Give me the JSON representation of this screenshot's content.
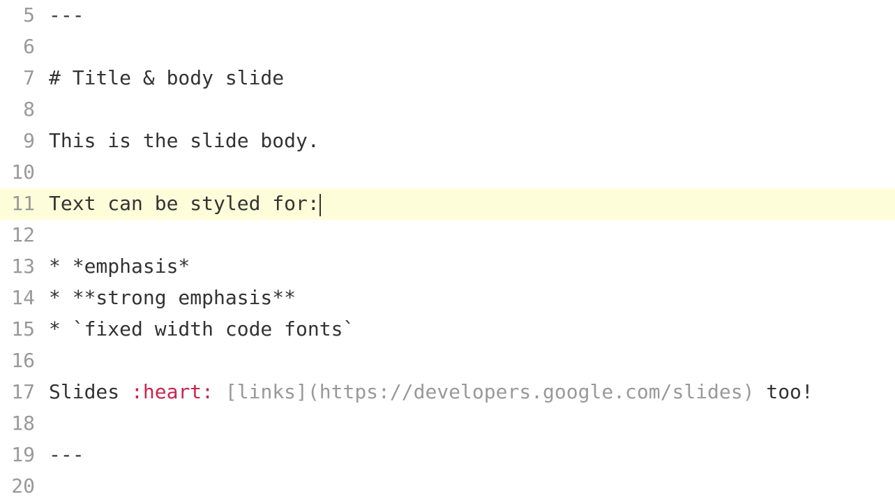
{
  "lines": [
    {
      "num": "5",
      "active": false,
      "segments": [
        {
          "text": "---"
        }
      ]
    },
    {
      "num": "6",
      "active": false,
      "segments": [
        {
          "text": ""
        }
      ]
    },
    {
      "num": "7",
      "active": false,
      "segments": [
        {
          "text": "# Title & body slide"
        }
      ]
    },
    {
      "num": "8",
      "active": false,
      "segments": [
        {
          "text": ""
        }
      ]
    },
    {
      "num": "9",
      "active": false,
      "segments": [
        {
          "text": "This is the slide body."
        }
      ]
    },
    {
      "num": "10",
      "active": false,
      "segments": [
        {
          "text": ""
        }
      ]
    },
    {
      "num": "11",
      "active": true,
      "cursor": true,
      "segments": [
        {
          "text": "Text can be styled for:"
        }
      ]
    },
    {
      "num": "12",
      "active": false,
      "segments": [
        {
          "text": ""
        }
      ]
    },
    {
      "num": "13",
      "active": false,
      "segments": [
        {
          "text": "* *emphasis*"
        }
      ]
    },
    {
      "num": "14",
      "active": false,
      "segments": [
        {
          "text": "* **strong emphasis**"
        }
      ]
    },
    {
      "num": "15",
      "active": false,
      "segments": [
        {
          "text": "* `fixed width code fonts`"
        }
      ]
    },
    {
      "num": "16",
      "active": false,
      "segments": [
        {
          "text": ""
        }
      ]
    },
    {
      "num": "17",
      "active": false,
      "segments": [
        {
          "text": "Slides "
        },
        {
          "text": ":heart:",
          "class": "emoji-code"
        },
        {
          "text": " "
        },
        {
          "text": "[links](https://developers.google.com/slides)",
          "class": "link-markup"
        },
        {
          "text": " too!"
        }
      ]
    },
    {
      "num": "18",
      "active": false,
      "segments": [
        {
          "text": ""
        }
      ]
    },
    {
      "num": "19",
      "active": false,
      "segments": [
        {
          "text": "---"
        }
      ]
    },
    {
      "num": "20",
      "active": false,
      "segments": [
        {
          "text": ""
        }
      ]
    }
  ]
}
